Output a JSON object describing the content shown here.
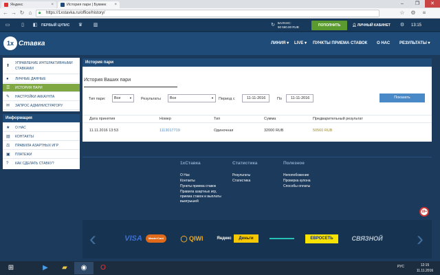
{
  "browser": {
    "tabs": [
      {
        "label": "Яндекс",
        "active": false
      },
      {
        "label": "История пари | Букмек",
        "active": true
      }
    ],
    "url": "https://1xstavka.ru/office/history/",
    "window_controls": [
      "–",
      "❐",
      "✕"
    ]
  },
  "topbar": {
    "first_cupis": "ПЕРВЫЙ ЦУПИС",
    "balance_label": "БАЛАНС:",
    "balance_value": "50 560.00 RUB",
    "deposit_label": "ПОПОЛНИТЬ",
    "cabinet_label": "ЛИЧНЫЙ КАБИНЕТ",
    "time": "13:15"
  },
  "header": {
    "logo_number": "1x",
    "logo_name": "Ставка",
    "nav": [
      "ЛИНИЯ",
      "LIVE",
      "ПУНКТЫ ПРИЕМА СТАВОК",
      "О НАС",
      "РЕЗУЛЬТАТЫ"
    ]
  },
  "sidebar": {
    "account_items": [
      {
        "label": "УПРАВЛЕНИЕ ИНТЕРАКТИВНЫМИ СТАВКАМИ",
        "icon": "upload-icon",
        "active": false
      },
      {
        "label": "ЛИЧНЫЕ ДАННЫЕ",
        "icon": "user-icon",
        "active": false
      },
      {
        "label": "ИСТОРИЯ ПАРИ",
        "icon": "list-icon",
        "active": true
      },
      {
        "label": "НАСТРОЙКИ АККАУНТА",
        "icon": "settings-icon",
        "active": false
      },
      {
        "label": "ЗАПРОС АДМИНИСТРАТОРУ",
        "icon": "mail-icon",
        "active": false
      }
    ],
    "info_title": "Информация",
    "info_items": [
      {
        "label": "О НАС",
        "icon": "star-icon"
      },
      {
        "label": "КОНТАКТЫ",
        "icon": "contacts-icon"
      },
      {
        "label": "ПРАВИЛА АЗАРТНЫХ ИГР",
        "icon": "rules-icon"
      },
      {
        "label": "ПЛАТЕЖИ",
        "icon": "payments-icon"
      },
      {
        "label": "КАК СДЕЛАТЬ СТАВКУ?",
        "icon": "question-icon"
      }
    ]
  },
  "main": {
    "panel_title": "История пари",
    "section_title": "История Ваших пари",
    "filters": {
      "bet_type_label": "Тип пари:",
      "bet_type_value": "Все",
      "results_label": "Результаты",
      "results_value": "Все",
      "period_label": "Период с",
      "date_from": "11-11-2016",
      "to_label": "По",
      "date_to": "11-11-2016",
      "show_button": "Показать"
    },
    "columns": [
      "Дата принятия",
      "Номер",
      "Тип",
      "Сумма",
      "Предварительный результат"
    ],
    "rows": [
      [
        "11.11.2016 13:53",
        "1113017719",
        "Одиночная",
        "32000 RUB",
        "50560 RUB"
      ]
    ]
  },
  "footer": {
    "col1_title": "1хСтавка",
    "col1_links": [
      "О Нас",
      "Контакты",
      "Пункты приема ставок",
      "Правила азартных игр, приема ставок и выплаты выигрышей"
    ],
    "col2_title": "Статистика",
    "col2_links": [
      "Результаты",
      "Статистика"
    ],
    "col3_title": "Полезное",
    "col3_links": [
      "Непопобожение",
      "Проверка купона",
      "Способы оплаты"
    ],
    "age_badge": "18+",
    "payments": [
      "VISA",
      "MasterCard",
      "QIWI",
      "Яндекс",
      "Деньги",
      "ЕВРОСЕТЬ",
      "СВЯЗНОЙ"
    ]
  },
  "taskbar": {
    "lang": "РУС",
    "time": "12:15",
    "date": "11.11.2016"
  }
}
